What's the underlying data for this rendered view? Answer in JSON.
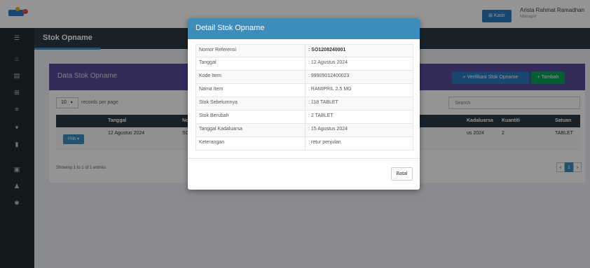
{
  "topbar": {
    "kasir_label": "Kasir",
    "user_name": "Arista Rahmat Ramadhan",
    "user_role": "Manager"
  },
  "page": {
    "title": "Stok Opname"
  },
  "box": {
    "title": "Data Stok Opname",
    "verif_label": "Verifikasi Stok Opname",
    "tambah_label": "Tambah",
    "length_value": "10",
    "length_label": "records per page",
    "search_placeholder": "Search",
    "columns": [
      "Tanggal",
      "No",
      "Kadaluarsa",
      "Kuantiti",
      "Satuan"
    ],
    "row": {
      "action": "Pilih",
      "tanggal": "12 Agustus 2024",
      "no": "SO",
      "kadaluarsa": "us 2024",
      "kuantiti": "2",
      "satuan": "TABLET"
    },
    "showing": "Showing 1 to 1 of 1 entries",
    "page_current": "1"
  },
  "modal": {
    "title": "Detail Stok Opname",
    "rows": [
      {
        "label": "Nomor Referensi",
        "value": ": SO1208240001"
      },
      {
        "label": "Tanggal",
        "value": ": 12 Agustus 2024"
      },
      {
        "label": "Kode Item",
        "value": ": 99909012400023"
      },
      {
        "label": "Nama Item",
        "value": ": RAMIPRIL 2.5 MG"
      },
      {
        "label": "Stok Sebelumnya",
        "value": ": 118 TABLET"
      },
      {
        "label": "Stok Berubah",
        "value": ": 2 TABLET"
      },
      {
        "label": "Tanggal Kadaluarsa",
        "value": ": 15 Agustus 2024"
      },
      {
        "label": "Keterangan",
        "value": ": retur penjulan"
      }
    ],
    "cancel_label": "Batal"
  },
  "colors": {
    "modal_header": "#3c8dbc",
    "sidebar": "#222d32",
    "box_header": "#5b4a9e",
    "success": "#00a65a"
  },
  "icons": [
    "menu-icon",
    "home-icon",
    "database-icon",
    "box-icon",
    "list-icon",
    "cart-icon",
    "file-icon",
    "chart-icon",
    "users-icon",
    "gear-icon"
  ]
}
